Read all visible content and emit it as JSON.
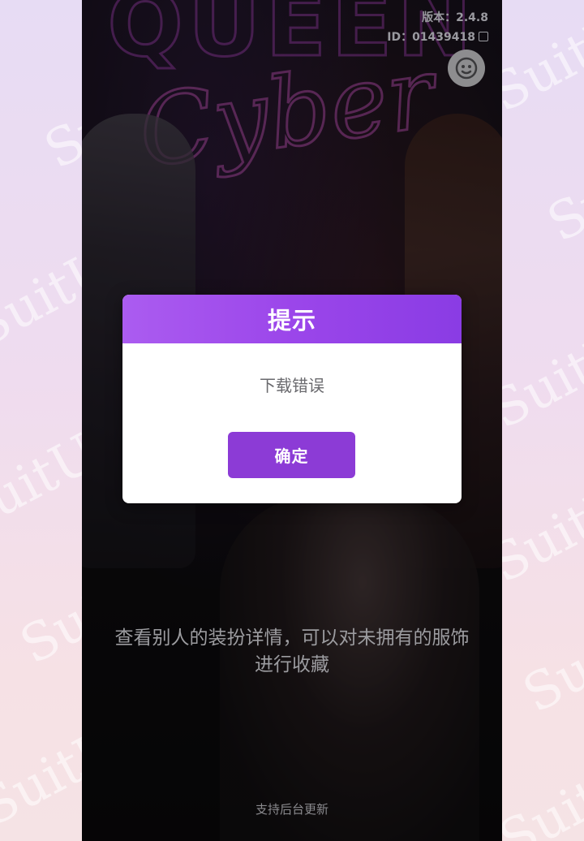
{
  "app": {
    "version_label": "版本：2.4.8",
    "user_id_label": "ID：01439418"
  },
  "watermark": {
    "text": "SuitU"
  },
  "dialog": {
    "title": "提示",
    "message": "下载错误",
    "confirm_label": "确定"
  },
  "tip": {
    "caption": "查看别人的装扮详情，可以对未拥有的服饰进行收藏"
  },
  "footer": {
    "status": "支持后台更新"
  },
  "colors": {
    "dialog_header": "#9b46ea",
    "confirm_button": "#8c3bd6"
  },
  "icons": {
    "copy": "copy-icon",
    "avatar": "chat-face-icon"
  }
}
